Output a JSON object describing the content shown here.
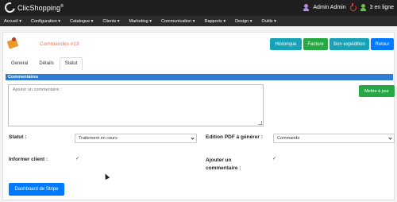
{
  "header": {
    "app_name": "ClicShopping",
    "app_sup": "®",
    "user": "Admin Admin",
    "online": "3 en ligne"
  },
  "menu": [
    "Accueil ▾",
    "Configuration ▾",
    "Catalogue ▾",
    "Clients ▾",
    "Marketing ▾",
    "Communication ▾",
    "Rapports ▾",
    "Design ▾",
    "Outils ▾"
  ],
  "order": {
    "title": "Commandes #23"
  },
  "actions": {
    "history": "Historique",
    "invoice": "Facture",
    "shipping": "Bon expédition",
    "back": "Retour"
  },
  "tabs": [
    "General",
    "Détails",
    "Statut"
  ],
  "section": {
    "title": "Commentaires"
  },
  "comment": {
    "placeholder": "Ajouter un commentaire :",
    "value": ""
  },
  "update_button": "Mettre à jour",
  "status": {
    "label": "Statut :",
    "selected": "Traitement en cours"
  },
  "pdf": {
    "label": "Edition PDF à générer :",
    "selected": "Commande"
  },
  "notify": {
    "label": "Informer client :",
    "checked": true
  },
  "add_comment": {
    "label_line1": "Ajouter un",
    "label_line2": "commentaire :",
    "checked": true
  },
  "stripe_button": "Dashboard de Stripe",
  "colors": {
    "topbar": "#1f1f1f",
    "menubar": "#2c2c2c",
    "section_bar": "#2e7dd1",
    "info": "#17a2b8",
    "success": "#28a745",
    "primary": "#007bff",
    "title": "#e8755a"
  }
}
